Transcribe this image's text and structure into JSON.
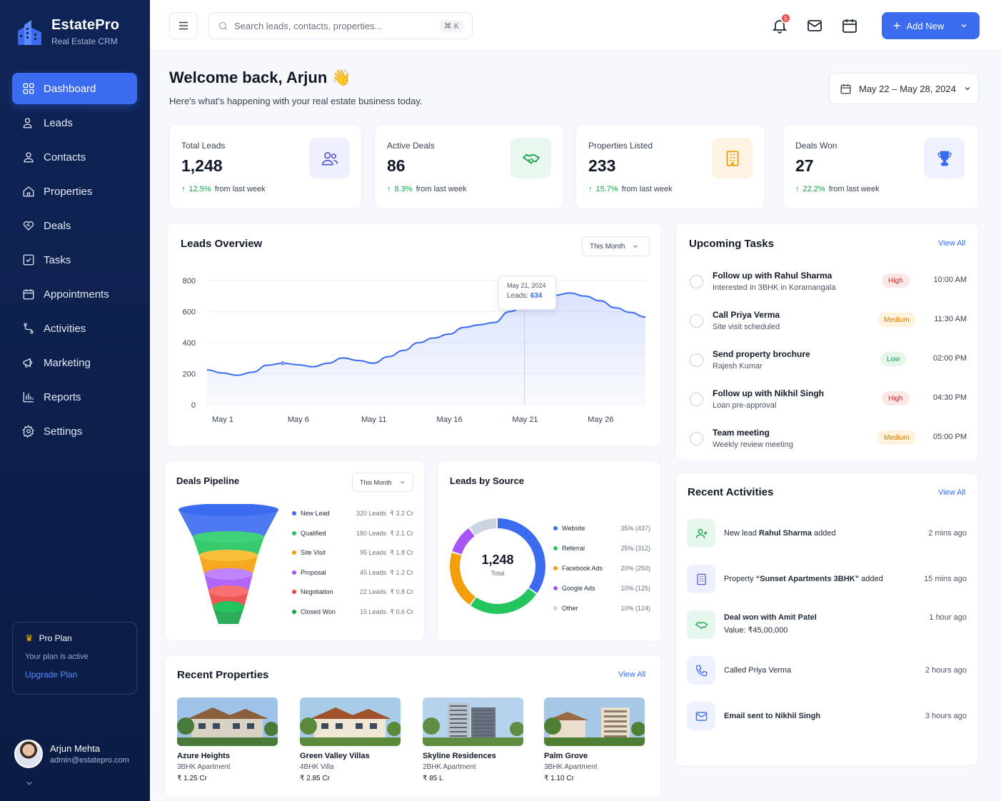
{
  "brand": {
    "name": "EstatePro",
    "subtitle": "Real Estate CRM"
  },
  "nav": [
    {
      "label": "Dashboard",
      "icon": "grid-icon"
    },
    {
      "label": "Leads",
      "icon": "user-plus-icon"
    },
    {
      "label": "Contacts",
      "icon": "user-icon"
    },
    {
      "label": "Properties",
      "icon": "home-icon"
    },
    {
      "label": "Deals",
      "icon": "handshake-icon"
    },
    {
      "label": "Tasks",
      "icon": "checkbox-icon"
    },
    {
      "label": "Appointments",
      "icon": "calendar-icon"
    },
    {
      "label": "Activities",
      "icon": "route-icon"
    },
    {
      "label": "Reports",
      "icon": "bar-chart-icon"
    },
    {
      "label": "Marketing",
      "icon": "megaphone-icon"
    },
    {
      "label": "Settings",
      "icon": "gear-icon"
    }
  ],
  "plan": {
    "title": "Pro Plan",
    "status": "Your plan is active",
    "upgrade": "Upgrade Plan"
  },
  "user": {
    "name": "Arjun Mehta",
    "email": "admin@estatepro.com"
  },
  "topbar": {
    "search_placeholder": "Search leads, contacts, properties...",
    "shortcut": "⌘ K",
    "notifications": "5",
    "add_new": "Add New"
  },
  "welcome": {
    "title": "Welcome back, Arjun 👋",
    "subtitle": "Here's what's happening with your real estate business today."
  },
  "date_range": "May 22 – May 28, 2024",
  "stats": [
    {
      "label": "Total Leads",
      "value": "1,248",
      "change": "12.5%",
      "suffix": "from last week",
      "icon": "users-icon"
    },
    {
      "label": "Active Deals",
      "value": "86",
      "change": "8.3%",
      "suffix": "from last week",
      "icon": "handshake-icon"
    },
    {
      "label": "Properties Listed",
      "value": "233",
      "change": "15.7%",
      "suffix": "from last week",
      "icon": "building-icon"
    },
    {
      "label": "Deals Won",
      "value": "27",
      "change": "22.2%",
      "suffix": "from last week",
      "icon": "trophy-icon"
    }
  ],
  "leads_overview": {
    "title": "Leads Overview",
    "filter": "This Month",
    "tooltip_date": "May 21, 2024",
    "tooltip_label": "Leads:",
    "tooltip_value": "634"
  },
  "tasks": {
    "title": "Upcoming Tasks",
    "view_all": "View All",
    "items": [
      {
        "title": "Follow up with Rahul Sharma",
        "sub": "Interested in 3BHK in Koramangala",
        "priority": "High",
        "time": "10:00 AM"
      },
      {
        "title": "Call Priya Verma",
        "sub": "Site visit scheduled",
        "priority": "Medium",
        "time": "11:30 AM"
      },
      {
        "title": "Send property brochure",
        "sub": "Rajesh Kumar",
        "priority": "Low",
        "time": "02:00 PM"
      },
      {
        "title": "Follow up with Nikhil Singh",
        "sub": "Loan pre-approval",
        "priority": "High",
        "time": "04:30 PM"
      },
      {
        "title": "Team meeting",
        "sub": "Weekly review meeting",
        "priority": "Medium",
        "time": "05:00 PM"
      }
    ]
  },
  "pipeline": {
    "title": "Deals Pipeline",
    "filter": "This Month",
    "stages": [
      {
        "name": "New Lead",
        "leads": "320 Leads",
        "value": "₹ 3.2 Cr",
        "color": "#3b6cf0"
      },
      {
        "name": "Qualified",
        "leads": "180 Leads",
        "value": "₹ 2.1 Cr",
        "color": "#22c55e"
      },
      {
        "name": "Site Visit",
        "leads": "95 Leads",
        "value": "₹ 1.8 Cr",
        "color": "#f59e0b"
      },
      {
        "name": "Proposal",
        "leads": "45 Leads",
        "value": "₹ 1.2 Cr",
        "color": "#a855f7"
      },
      {
        "name": "Negotiation",
        "leads": "22 Leads",
        "value": "₹ 0.8 Cr",
        "color": "#ef4444"
      },
      {
        "name": "Closed Won",
        "leads": "15 Leads",
        "value": "₹ 0.6 Cr",
        "color": "#16a34a"
      }
    ]
  },
  "sources": {
    "title": "Leads by Source",
    "total": "1,248",
    "total_label": "Total",
    "items": [
      {
        "name": "Website",
        "pct": "35% (437)",
        "color": "#3b6cf0"
      },
      {
        "name": "Referral",
        "pct": "25% (312)",
        "color": "#22c55e"
      },
      {
        "name": "Facebook Ads",
        "pct": "20% (250)",
        "color": "#f59e0b"
      },
      {
        "name": "Google Ads",
        "pct": "10% (125)",
        "color": "#a855f7"
      },
      {
        "name": "Other",
        "pct": "10% (124)",
        "color": "#cbd5e1"
      }
    ]
  },
  "activities": {
    "title": "Recent Activities",
    "view_all": "View All",
    "items": [
      {
        "pre": "New lead ",
        "bold": "Rahul Sharma",
        "post": " added",
        "time": "2 mins ago",
        "icon": "user-plus-icon"
      },
      {
        "pre": "Property ",
        "bold": "“Sunset Apartments 3BHK”",
        "post": " added",
        "time": "15 mins ago",
        "icon": "building-icon"
      },
      {
        "pre": "",
        "bold": "Deal won with Amit Patel",
        "post": "",
        "line2": "Value: ₹45,00,000",
        "time": "1 hour ago",
        "icon": "handshake-icon"
      },
      {
        "pre": "Called Priya Verma",
        "bold": "",
        "post": "",
        "time": "2 hours ago",
        "icon": "phone-icon"
      },
      {
        "pre": "",
        "bold": "Email sent to Nikhil Singh",
        "post": "",
        "time": "3 hours ago",
        "icon": "mail-icon"
      }
    ]
  },
  "properties": {
    "title": "Recent Properties",
    "view_all": "View All",
    "items": [
      {
        "name": "Azure Heights",
        "type": "3BHK Apartment",
        "price": "₹ 1.25 Cr"
      },
      {
        "name": "Green Valley Villas",
        "type": "4BHK Villa",
        "price": "₹ 2.85 Cr"
      },
      {
        "name": "Skyline Residences",
        "type": "2BHK Apartment",
        "price": "₹ 85 L"
      },
      {
        "name": "Palm Grove",
        "type": "3BHK Apartment",
        "price": "₹ 1.10 Cr"
      }
    ]
  },
  "chart_data": [
    {
      "type": "area",
      "title": "Leads Overview",
      "x": [
        "May 1",
        "May 2",
        "May 3",
        "May 4",
        "May 5",
        "May 6",
        "May 7",
        "May 8",
        "May 9",
        "May 10",
        "May 11",
        "May 12",
        "May 13",
        "May 14",
        "May 15",
        "May 16",
        "May 17",
        "May 18",
        "May 19",
        "May 20",
        "May 21",
        "May 22",
        "May 23",
        "May 24",
        "May 25",
        "May 26",
        "May 27",
        "May 28",
        "May 29",
        "May 30"
      ],
      "x_ticks": [
        "May 1",
        "May 6",
        "May 11",
        "May 16",
        "May 21",
        "May 26"
      ],
      "y_ticks": [
        "0",
        "200",
        "400",
        "600",
        "800"
      ],
      "ylim": [
        0,
        800
      ],
      "values": [
        225,
        205,
        190,
        210,
        255,
        268,
        258,
        245,
        268,
        302,
        285,
        268,
        310,
        350,
        400,
        430,
        455,
        498,
        515,
        530,
        600,
        634,
        665,
        705,
        720,
        700,
        670,
        625,
        595,
        565
      ],
      "grid": true
    },
    {
      "type": "pie",
      "title": "Leads by Source",
      "categories": [
        "Website",
        "Referral",
        "Facebook Ads",
        "Google Ads",
        "Other"
      ],
      "values": [
        437,
        312,
        250,
        125,
        124
      ]
    }
  ]
}
